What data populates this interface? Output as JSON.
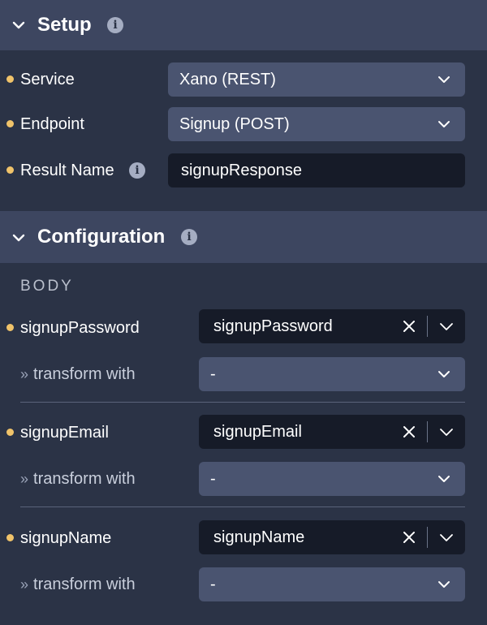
{
  "setup": {
    "title": "Setup",
    "fields": {
      "service": {
        "label": "Service",
        "value": "Xano (REST)"
      },
      "endpoint": {
        "label": "Endpoint",
        "value": "Signup (POST)"
      },
      "result_name": {
        "label": "Result Name",
        "value": "signupResponse"
      }
    }
  },
  "configuration": {
    "title": "Configuration",
    "group_label": "BODY",
    "params": [
      {
        "label": "signupPassword",
        "value": "signupPassword",
        "transform_label": "transform with",
        "transform_value": "-"
      },
      {
        "label": "signupEmail",
        "value": "signupEmail",
        "transform_label": "transform with",
        "transform_value": "-"
      },
      {
        "label": "signupName",
        "value": "signupName",
        "transform_label": "transform with",
        "transform_value": "-"
      }
    ]
  },
  "icons": {
    "collapse": "chevron-down-icon",
    "info": "info-icon",
    "clear": "close-icon",
    "dropdown": "chevron-down-icon",
    "transform": "double-chevron-right-icon"
  },
  "colors": {
    "background": "#2b3346",
    "header": "#3d4660",
    "select": "#4a5470",
    "input": "#161b28",
    "required_dot": "#f0c36a"
  }
}
